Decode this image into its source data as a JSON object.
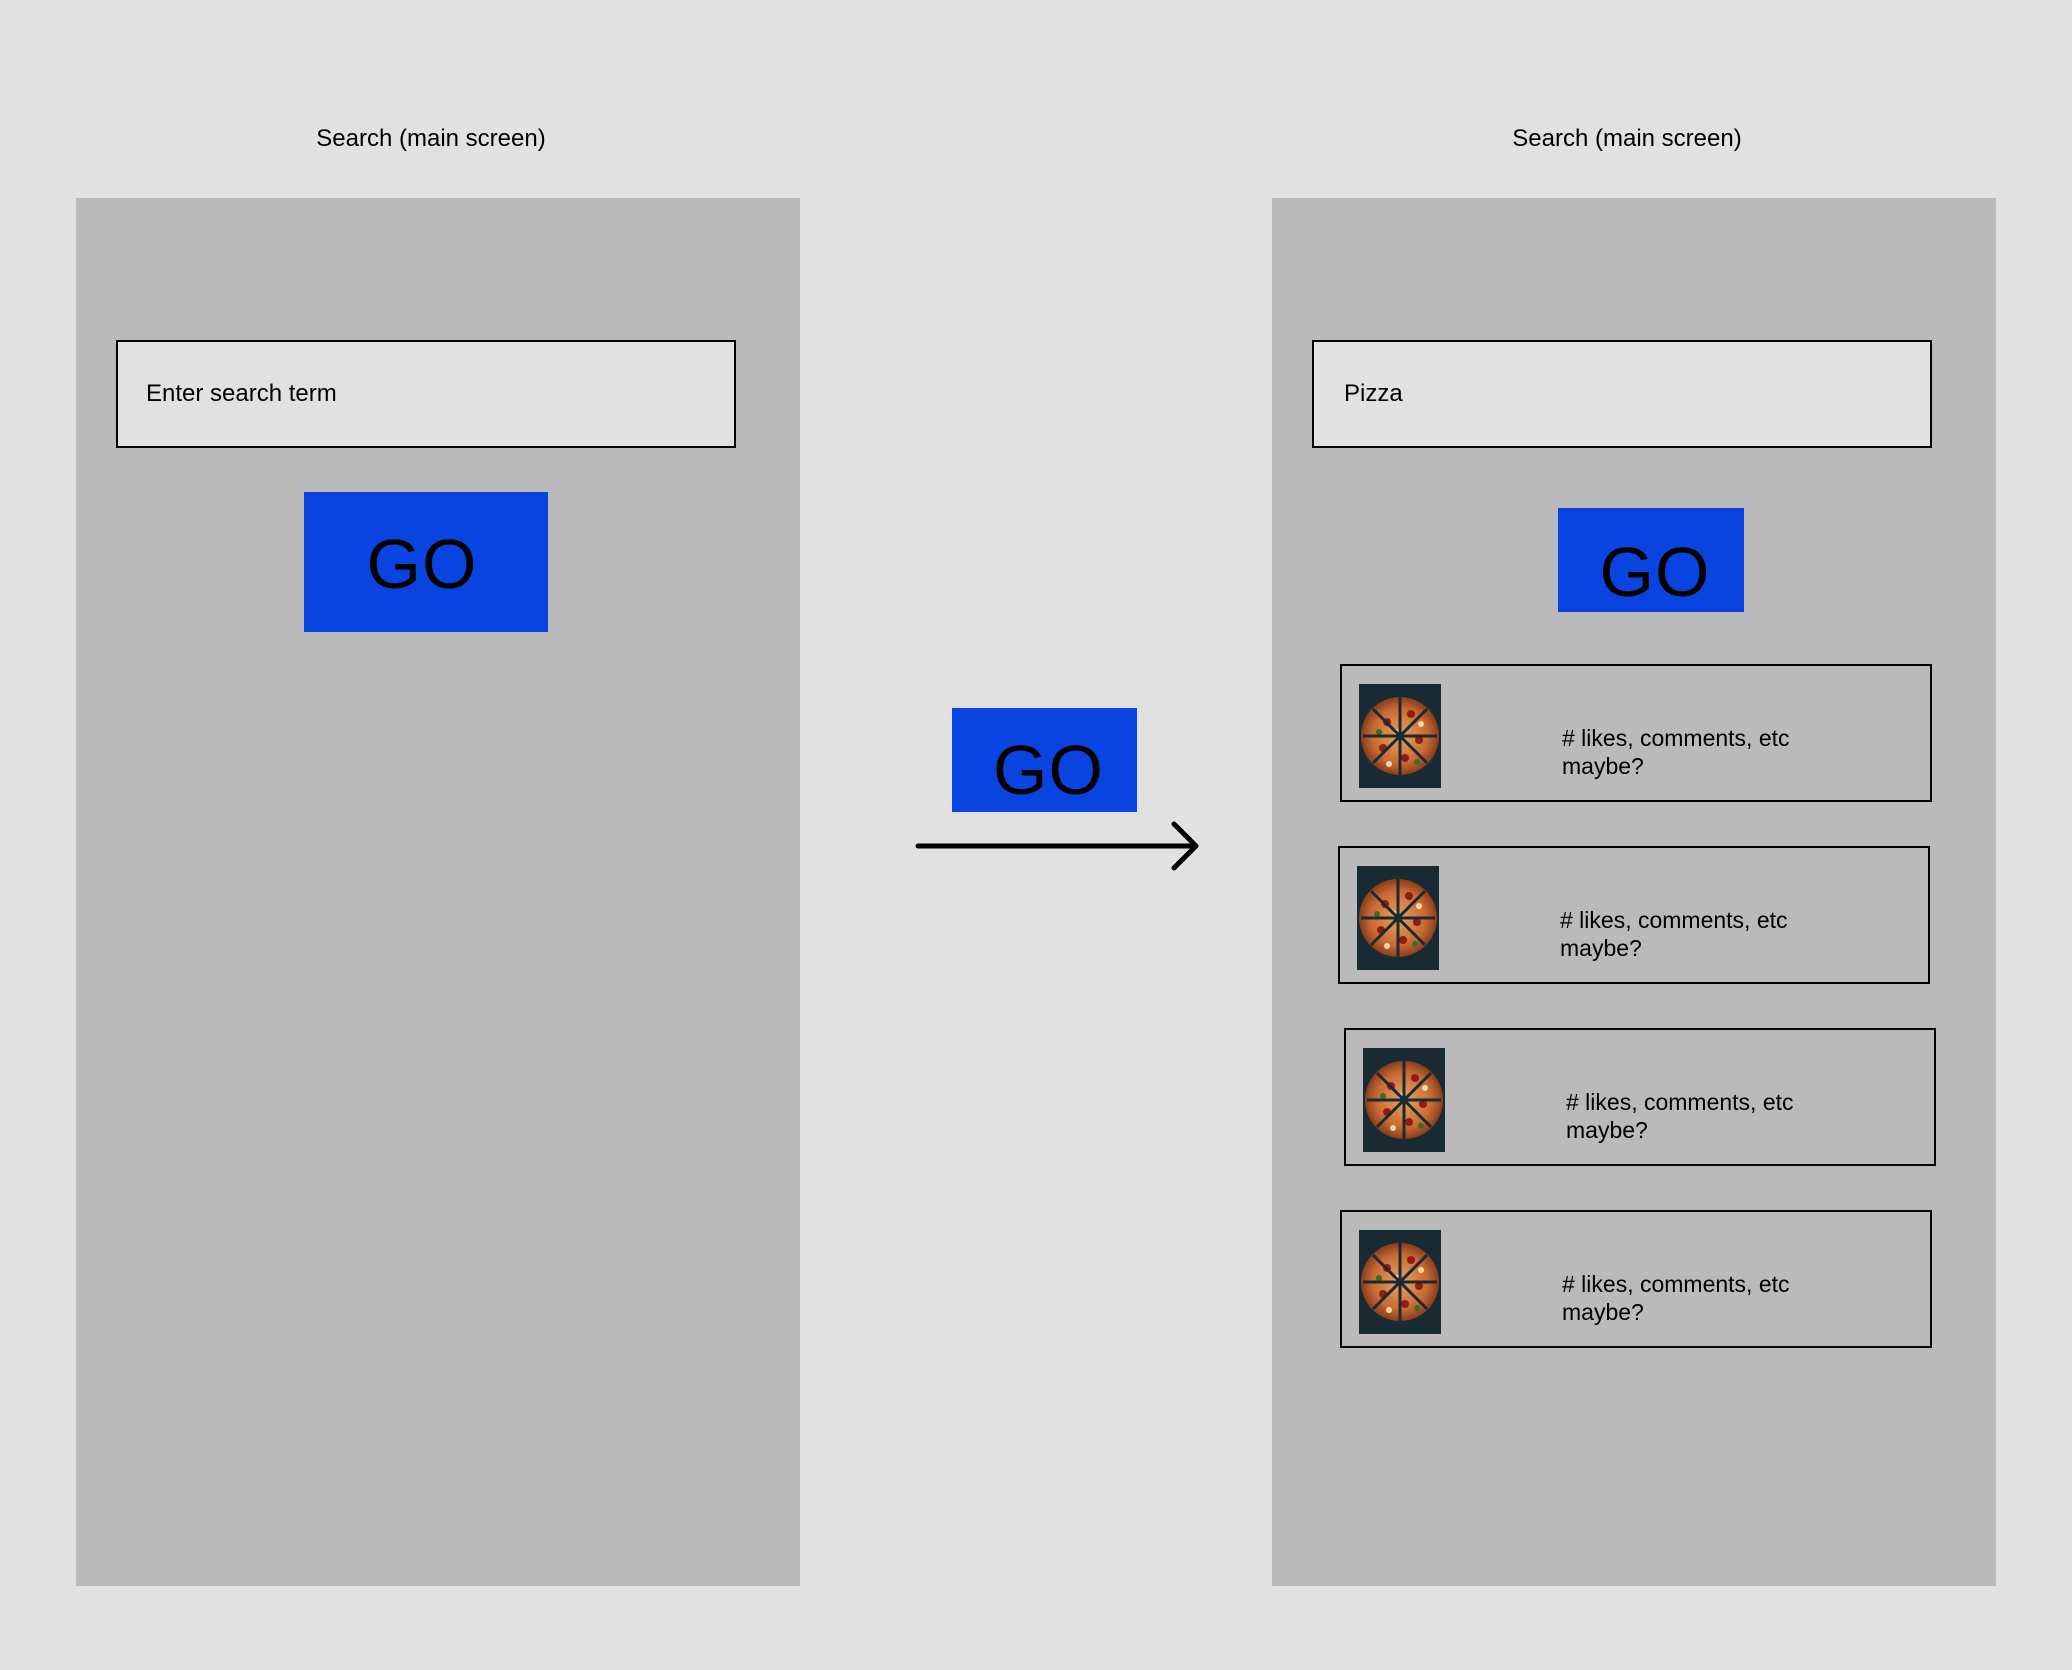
{
  "left_screen": {
    "title": "Search (main screen)",
    "search_placeholder": "Enter search term",
    "go_label": "GO"
  },
  "transition": {
    "go_label": "GO"
  },
  "right_screen": {
    "title": "Search (main screen)",
    "search_value": "Pizza",
    "go_label": "GO",
    "results": [
      {
        "thumbnail": "pizza-image",
        "text": "# likes, comments, etc maybe?"
      },
      {
        "thumbnail": "pizza-image",
        "text": "# likes, comments, etc maybe?"
      },
      {
        "thumbnail": "pizza-image",
        "text": "# likes, comments, etc maybe?"
      },
      {
        "thumbnail": "pizza-image",
        "text": "# likes, comments, etc maybe?"
      }
    ]
  },
  "colors": {
    "background": "#e1e1e1",
    "screen": "#bababa",
    "go_button": "#0a44e0"
  }
}
